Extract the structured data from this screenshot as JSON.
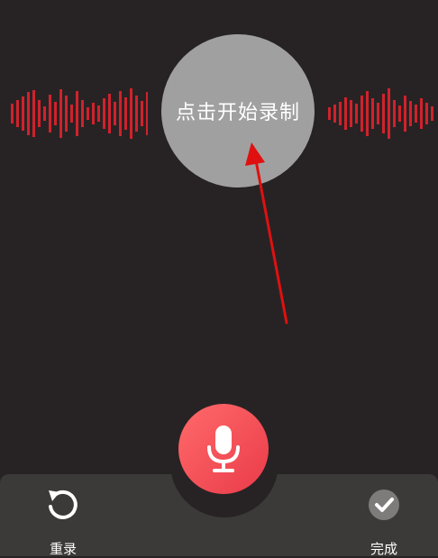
{
  "record_prompt": {
    "label": "点击开始录制"
  },
  "actions": {
    "rerecord_label": "重录",
    "done_label": "完成"
  },
  "icons": {
    "rerecord": "rotate-ccw-icon",
    "mic": "microphone-icon",
    "done": "check-circle-icon"
  },
  "colors": {
    "background": "#272324",
    "waveform": "#d0222c",
    "record_circle": "#a1a0a0",
    "mic_button": "#f2475a",
    "bottom_bar": "#3c3939",
    "arrow": "#e01010"
  }
}
